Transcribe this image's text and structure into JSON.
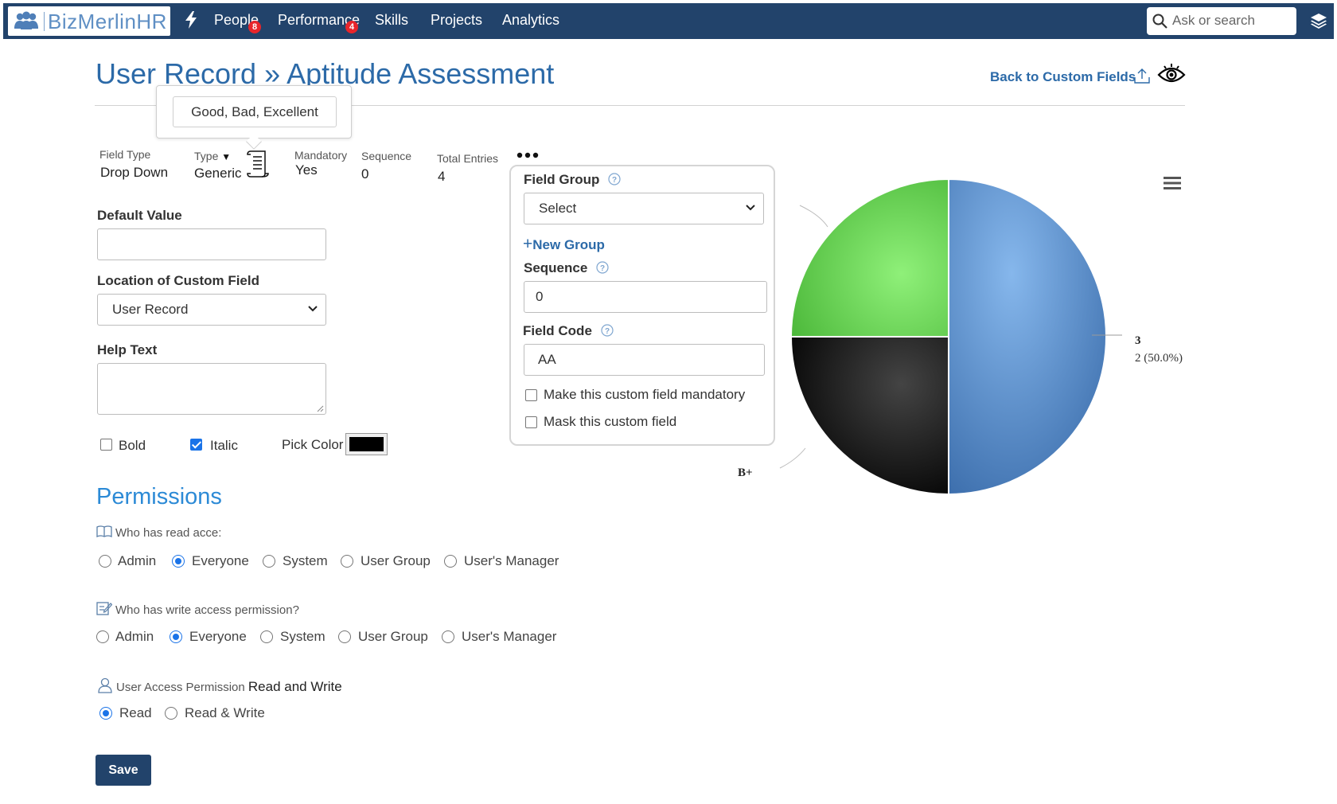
{
  "nav": {
    "brand": "BizMerlinHR",
    "items": [
      {
        "label": "People",
        "badge": "8"
      },
      {
        "label": "Performance",
        "badge": "4"
      },
      {
        "label": "Skills",
        "badge": ""
      },
      {
        "label": "Projects",
        "badge": ""
      },
      {
        "label": "Analytics",
        "badge": ""
      }
    ],
    "search_placeholder": "Ask or search"
  },
  "header": {
    "title": "User Record » Aptitude Assessment",
    "back_link": "Back to Custom Fields"
  },
  "popover": {
    "text": "Good, Bad, Excellent"
  },
  "meta": {
    "field_type_label": "Field Type",
    "field_type_value": "Drop Down",
    "type_label": "Type",
    "type_value": "Generic",
    "mandatory_label": "Mandatory",
    "mandatory_value": "Yes",
    "sequence_label": "Sequence",
    "sequence_value": "0",
    "total_entries_label": "Total Entries",
    "total_entries_value": "4"
  },
  "form": {
    "default_value_label": "Default Value",
    "default_value": "",
    "location_label": "Location of Custom Field",
    "location_value": "User Record",
    "help_text_label": "Help Text",
    "help_text_value": "",
    "bold_label": "Bold",
    "bold_checked": false,
    "italic_label": "Italic",
    "italic_checked": true,
    "pick_color_label": "Pick Color",
    "pick_color_value": "#000000"
  },
  "panel": {
    "field_group_label": "Field Group",
    "field_group_value": "Select",
    "new_group_label": "New Group",
    "sequence_label": "Sequence",
    "sequence_value": "0",
    "field_code_label": "Field Code",
    "field_code_value": "AA",
    "mandatory_checkbox_label": "Make this custom field mandatory",
    "mask_checkbox_label": "Mask this custom field"
  },
  "permissions": {
    "title": "Permissions",
    "read_question": "Who has read acce:",
    "write_question": "Who has write access permission?",
    "options": [
      "Admin",
      "Everyone",
      "System",
      "User Group",
      "User's Manager"
    ],
    "read_selected": "Everyone",
    "write_selected": "Everyone",
    "user_access_label": "User Access Permission",
    "user_access_value": "Read and Write",
    "user_access_options": [
      "Read",
      "Read & Write"
    ],
    "user_access_selected": "Read"
  },
  "actions": {
    "save_label": "Save"
  },
  "chart_data": {
    "type": "pie",
    "slices": [
      {
        "label": "3",
        "value": 2,
        "percent_label": "2 (50.0%)",
        "color": "#4f86c6"
      },
      {
        "label": "B+",
        "value": 1,
        "percent_label": "",
        "color": "#1c1c1c"
      },
      {
        "label": "",
        "value": 1,
        "percent_label": "",
        "color": "#6cd65a"
      }
    ]
  }
}
